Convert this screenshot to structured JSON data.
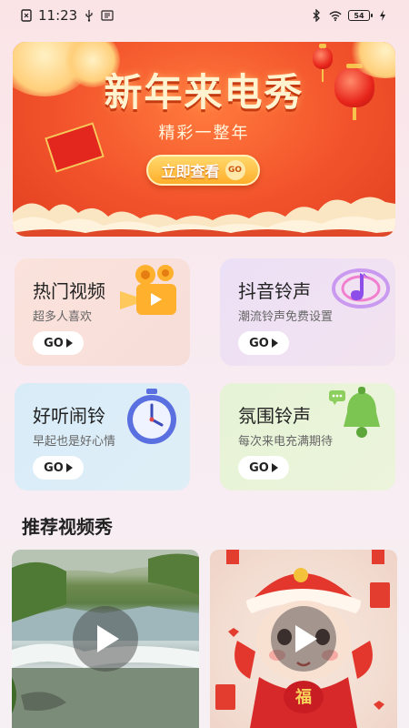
{
  "status_bar": {
    "time": "11:23",
    "battery": "54"
  },
  "banner": {
    "title": "新年来电秀",
    "subtitle": "精彩一整年",
    "button_label": "立即查看",
    "button_badge": "GO",
    "badge_char": "福"
  },
  "categories": [
    {
      "title": "热门视频",
      "subtitle": "超多人喜欢",
      "go": "GO",
      "icon": "video-camera-icon"
    },
    {
      "title": "抖音铃声",
      "subtitle": "潮流铃声免费设置",
      "go": "GO",
      "icon": "music-note-icon"
    },
    {
      "title": "好听闹铃",
      "subtitle": "早起也是好心情",
      "go": "GO",
      "icon": "alarm-clock-icon"
    },
    {
      "title": "氛围铃声",
      "subtitle": "每次来电充满期待",
      "go": "GO",
      "icon": "bell-icon"
    }
  ],
  "section": {
    "title": "推荐视频秀"
  },
  "videos": [
    {
      "scene": "river",
      "badge": ""
    },
    {
      "scene": "baby",
      "badge": "福"
    }
  ],
  "colors": {
    "banner_red": "#f2522b",
    "banner_gold": "#ffc13b",
    "card_video": "#fbe3dc",
    "card_ring": "#ece0f6",
    "card_alarm": "#d8ecf8",
    "card_atmos": "#e6f3d6"
  }
}
